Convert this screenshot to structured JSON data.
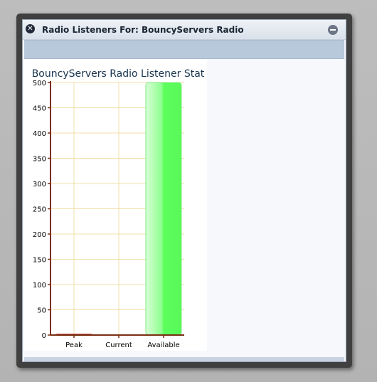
{
  "window": {
    "title": "Radio Listeners For: BouncyServers Radio",
    "close_icon": "close-icon",
    "minimize_icon": "minimize-icon"
  },
  "colors": {
    "titlebar": "#dde4ec",
    "toolbar": "#b8c9dc",
    "axis": "#7a2e10",
    "grid": "#f2dfa8",
    "available_bar": "#5dff5d",
    "peak_bar": "#e05050"
  },
  "chart_data": {
    "type": "bar",
    "title": "BouncyServers Radio Listener Stat",
    "categories": [
      "Peak",
      "Current",
      "Available"
    ],
    "values": [
      2,
      0,
      500
    ],
    "yticks": [
      "0",
      "50",
      "100",
      "150",
      "200",
      "250",
      "300",
      "350",
      "400",
      "450",
      "500"
    ],
    "ylim": [
      0,
      500
    ],
    "xlabel": "",
    "ylabel": "",
    "grid": true
  }
}
